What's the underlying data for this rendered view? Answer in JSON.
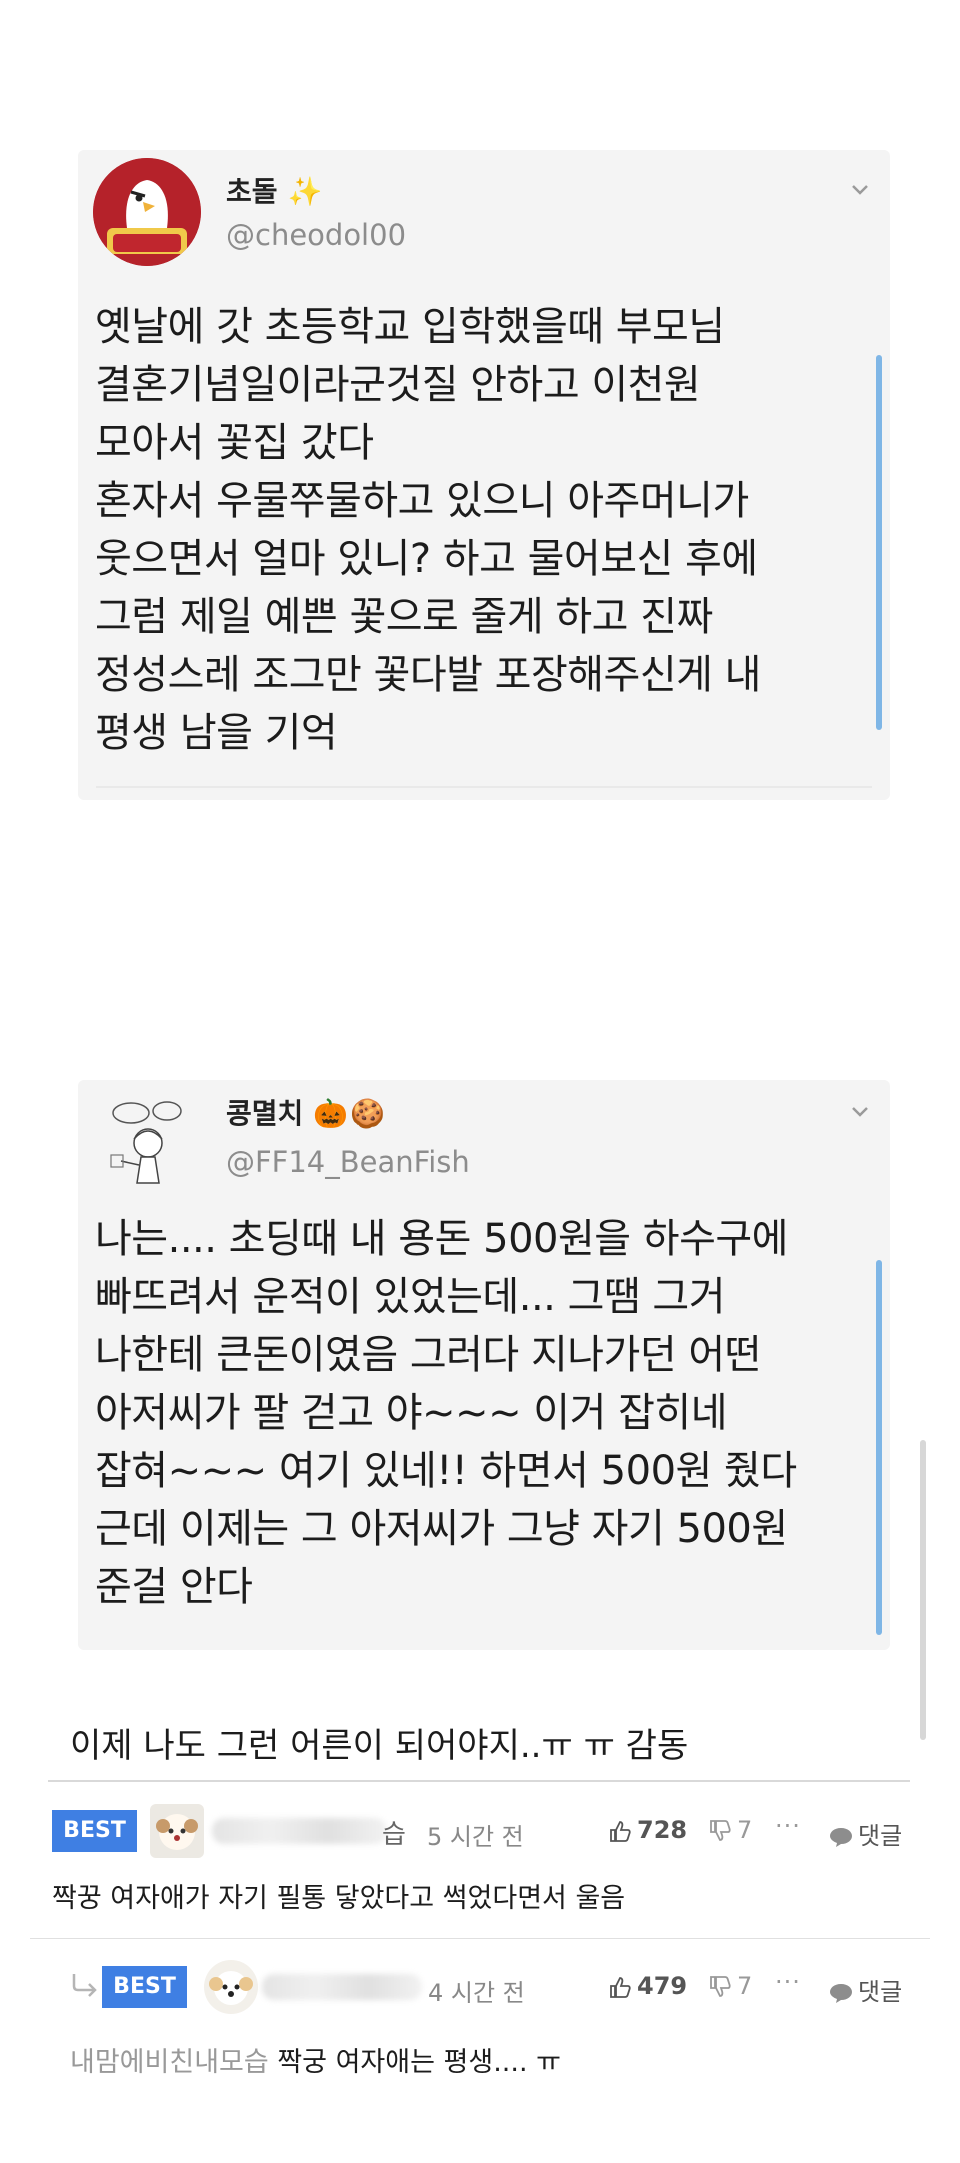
{
  "tweet1": {
    "name": "초돌",
    "handle": "@cheodol00",
    "text": "옛날에 갓 초등학교 입학했을때 부모님\n결혼기념일이라군것질 안하고 이천원\n모아서 꽃집 갔다\n혼자서 우물쭈물하고 있으니 아주머니가\n웃으면서 얼마 있니? 하고 물어보신 후에\n그럼 제일 예쁜 꽃으로 줄게 하고 진짜\n정성스레 조그만 꽃다발 포장해주신게 내\n평생 남을 기억"
  },
  "tweet2": {
    "name": "콩멸치",
    "handle": "@FF14_BeanFish",
    "text": "나는.... 초딩때 내 용돈 500원을 하수구에\n빠뜨려서 운적이 있었는데... 그땜 그거\n나한테 큰돈이였음 그러다 지나가던 어떤\n아저씨가 팔 걷고 야~~~ 이거 잡히네\n잡혀~~~ 여기 있네!! 하면서 500원 줬다\n근데 이제는 그 아저씨가 그냥 자기 500원\n준걸 안다"
  },
  "caption": "이제 나도 그런 어른이 되어야지..ㅠ ㅠ 감동",
  "comments": [
    {
      "badge": "BEST",
      "name_tail": "습",
      "time": "5 시간 전",
      "likes": "728",
      "dislikes": "7",
      "more": "···",
      "reply_label": "댓글",
      "text": "짝꿍 여자애가 자기 필통 닿았다고 썩었다면서 울음"
    },
    {
      "badge": "BEST",
      "name_tail": "",
      "time": "4 시간 전",
      "likes": "479",
      "dislikes": "7",
      "more": "···",
      "reply_label": "댓글",
      "prefix": "내맘에비친내모습",
      "text": " 짝궁 여자애는 평생.... ㅠ"
    }
  ],
  "colors": {
    "best_badge": "#3f7fe3",
    "tweet_bg": "#f4f4f4",
    "scroll_indicator": "#7fb6e6"
  },
  "icons": [
    "chevron-down-icon",
    "sparkle-icon",
    "pumpkin-icon",
    "cookie-icon",
    "thumbs-up-icon",
    "thumbs-down-icon",
    "speech-bubble-icon",
    "reply-arrow-icon"
  ]
}
